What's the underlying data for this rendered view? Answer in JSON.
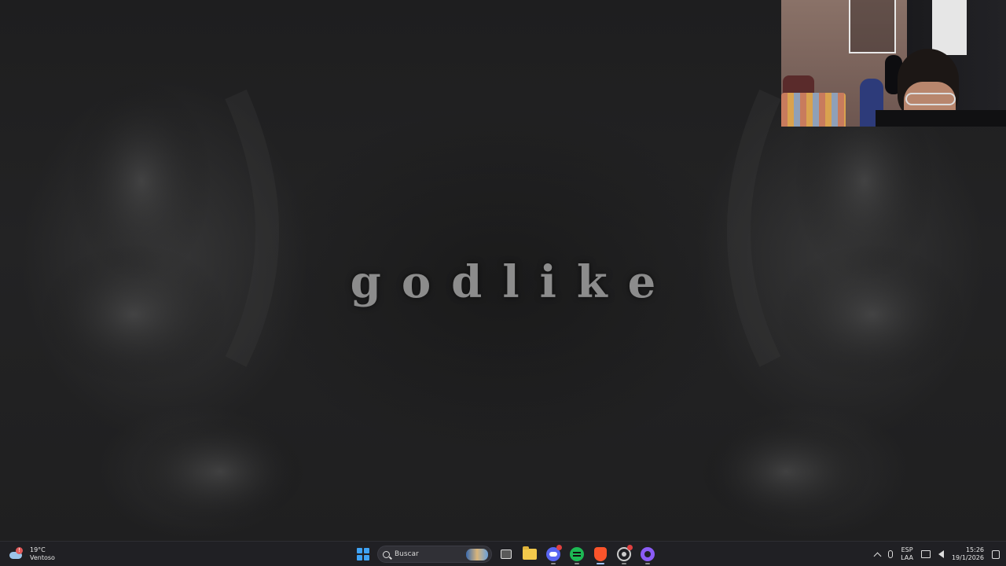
{
  "desktop": {
    "wallpaper_title": "godlike"
  },
  "taskbar": {
    "weather": {
      "temperature": "19°C",
      "condition": "Ventoso",
      "icon": "cloud-icon",
      "badge": "!"
    },
    "start_icon": "windows-start-icon",
    "search": {
      "placeholder": "Buscar"
    },
    "apps": [
      {
        "name": "task-view-icon"
      },
      {
        "name": "file-explorer-icon"
      },
      {
        "name": "discord-icon"
      },
      {
        "name": "spotify-icon"
      },
      {
        "name": "brave-browser-icon"
      },
      {
        "name": "chrome-icon"
      },
      {
        "name": "app-circle-icon"
      }
    ],
    "tray": {
      "language_line1": "ESP",
      "language_line2": "LAA",
      "time": "15:26",
      "date": "19/1/2026"
    }
  },
  "colors": {
    "taskbar_bg": "#202024",
    "wallpaper_text": "#8c8c8c",
    "windows_blue": "#3fa3f5"
  }
}
